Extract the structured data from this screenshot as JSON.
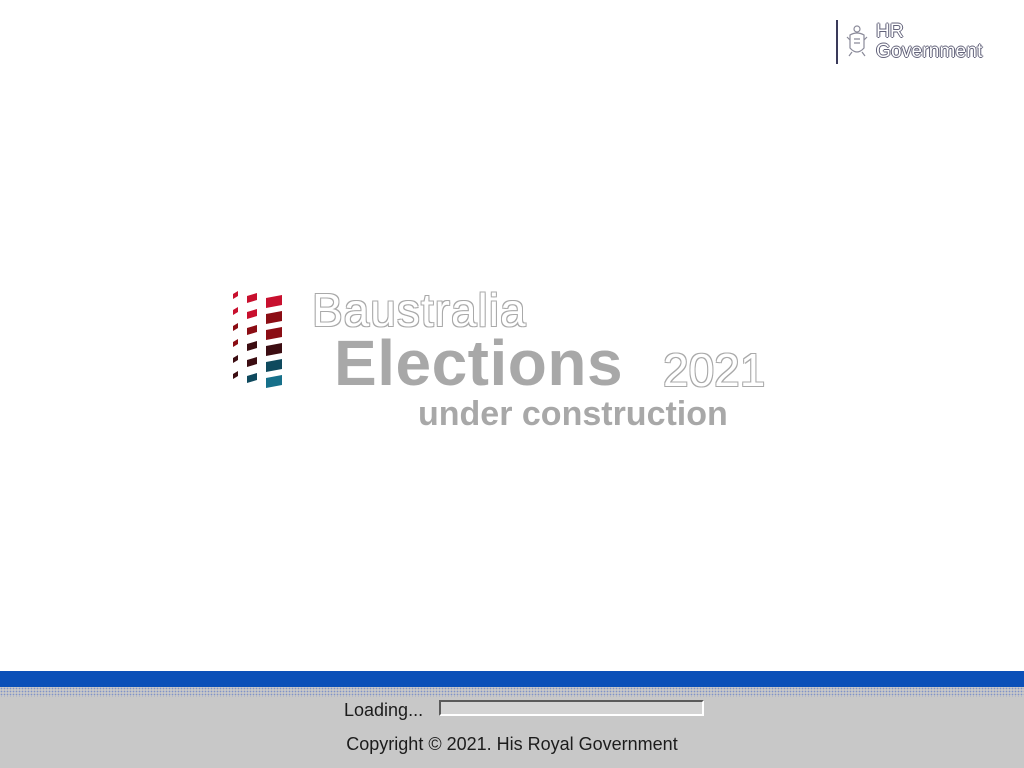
{
  "header": {
    "logo": {
      "line1": "HR",
      "line2": "Government",
      "icon": "crest-icon"
    }
  },
  "brand": {
    "line1": "Baustralia",
    "line2": "Elections",
    "year": "2021",
    "line3": "under construction",
    "icon": "ballot-grid-icon",
    "colors": [
      "#c8102e",
      "#8b0d14",
      "#3c0d12",
      "#0f4a5e",
      "#16708a"
    ]
  },
  "status": {
    "loading_label": "Loading...",
    "progress": 0
  },
  "footer": {
    "copyright": "Copyright © 2021. His Royal Government"
  },
  "theme": {
    "accent": "#0b50b8",
    "footer_bg": "#c8c8c8",
    "logo_text": "#a8a8a8"
  }
}
